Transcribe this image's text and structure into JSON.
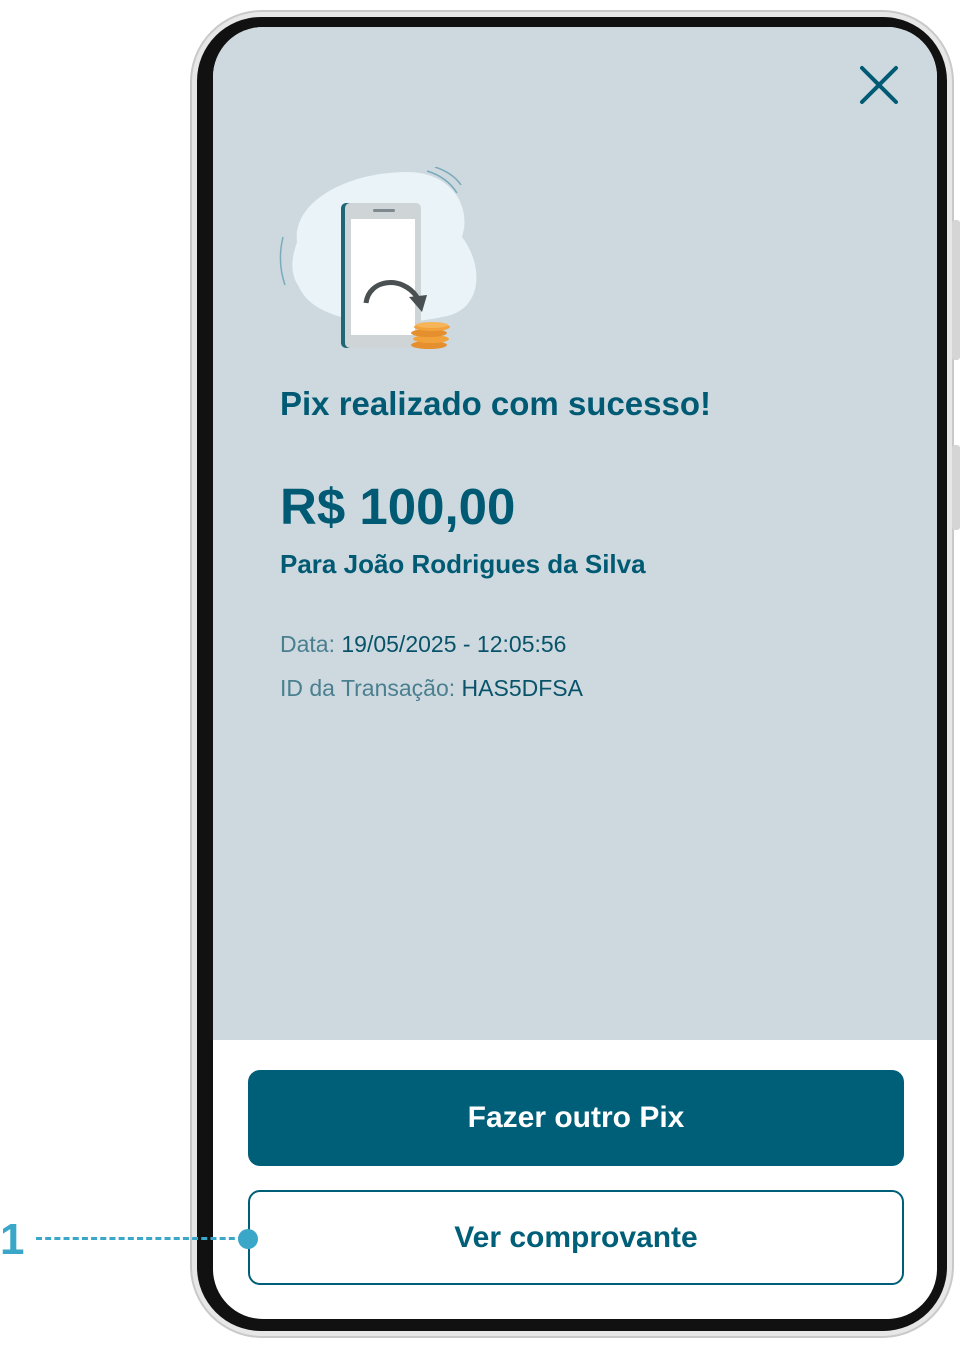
{
  "screen": {
    "title": "Pix realizado com sucesso!",
    "amount": "R$ 100,00",
    "recipient": "Para João Rodrigues da Silva",
    "details": {
      "date_label": "Data:",
      "date_value": "19/05/2025 - 12:05:56",
      "transaction_label": "ID da Transação:",
      "transaction_value": "HAS5DFSA"
    },
    "actions": {
      "primary_label": "Fazer outro Pix",
      "secondary_label": "Ver comprovante"
    },
    "icons": {
      "close": "close-icon",
      "illustration": "phone-transfer-coins-illustration"
    }
  },
  "annotation": {
    "number": "1"
  },
  "colors": {
    "brand": "#005f78",
    "content_background": "#cdd9df",
    "annotation": "#3aa7c9"
  }
}
